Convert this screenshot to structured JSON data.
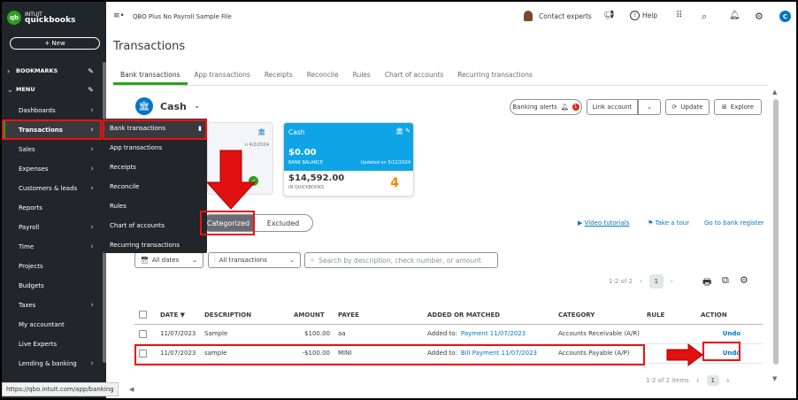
{
  "sidebar": {
    "logo_small": "INTUIT",
    "logo_brand": "quickbooks",
    "logo_mark": "qb",
    "new_label": "+ New",
    "sections": {
      "bookmarks": "BOOKMARKS",
      "menu": "MENU"
    },
    "items": [
      {
        "label": "Dashboards",
        "chev": true
      },
      {
        "label": "Transactions",
        "chev": true
      },
      {
        "label": "Sales",
        "chev": true
      },
      {
        "label": "Expenses",
        "chev": true
      },
      {
        "label": "Customers & leads",
        "chev": true
      },
      {
        "label": "Reports",
        "chev": false
      },
      {
        "label": "Payroll",
        "chev": true
      },
      {
        "label": "Time",
        "chev": true
      },
      {
        "label": "Projects",
        "chev": false
      },
      {
        "label": "Budgets",
        "chev": false
      },
      {
        "label": "Taxes",
        "chev": true
      },
      {
        "label": "My accountant",
        "chev": false
      },
      {
        "label": "Live Experts",
        "chev": false
      },
      {
        "label": "Lending & banking",
        "chev": true
      }
    ]
  },
  "flyout": [
    "Bank transactions",
    "App transactions",
    "Receipts",
    "Reconcile",
    "Rules",
    "Chart of accounts",
    "Recurring transactions"
  ],
  "status_url": "https://qbo.intuit.com/app/banking",
  "topbar": {
    "menu_icon": "≡•",
    "company": "QBO Plus No Payroll Sample File",
    "contact": "Contact experts",
    "help": "Help",
    "avatar": "C"
  },
  "page_title": "Transactions",
  "tabs": [
    "Bank transactions",
    "App transactions",
    "Receipts",
    "Reconcile",
    "Rules",
    "Chart of accounts",
    "Recurring transactions"
  ],
  "account": {
    "name": "Cash"
  },
  "actions": {
    "banking_alerts": "Banking alerts",
    "alerts_count": "1",
    "link_account": "Link account",
    "update": "Update",
    "explore": "Explore"
  },
  "card_gray": {
    "date": "n 4/2/2024"
  },
  "card_cash": {
    "title": "Cash",
    "bank_balance": "$0.00",
    "bank_label": "BANK BALANCE",
    "updated": "Updated on 5/12/2024",
    "qb_balance": "$14,592.00",
    "qb_label": "IN QUICKBOOKS",
    "count": "4"
  },
  "status_tabs": {
    "categorized": "Categorized",
    "excluded": "Excluded"
  },
  "help_links": {
    "video": "Video tutorials",
    "tour": "Take a tour",
    "register": "Go to bank register"
  },
  "filters": {
    "dates": "All dates",
    "transactions": "All transactions",
    "search_placeholder": "Search by description, check number, or amount"
  },
  "pagination": {
    "top": "1-2 of 2",
    "page": "1",
    "bottom": "1-2 of 2 items"
  },
  "table": {
    "headers": [
      "DATE ▼",
      "DESCRIPTION",
      "AMOUNT",
      "PAYEE",
      "ADDED OR MATCHED",
      "CATEGORY",
      "RULE",
      "ACTION"
    ],
    "rows": [
      {
        "date": "11/07/2023",
        "description": "Sample",
        "amount": "$100.00",
        "payee": "aa",
        "added_prefix": "Added to:",
        "added_link": "Payment 11/07/2023",
        "category": "Accounts Receivable (A/R)",
        "rule": "",
        "action": "Undo"
      },
      {
        "date": "11/07/2023",
        "description": "sample",
        "amount": "-$100.00",
        "payee": "MINI",
        "added_prefix": "Added to:",
        "added_link": "Bill Payment 11/07/2023",
        "category": "Accounts Payable (A/P)",
        "rule": "",
        "action": "Undo"
      }
    ]
  },
  "colors": {
    "brand_green": "#2ca01c",
    "sidebar_bg": "#21262a",
    "link_blue": "#0077c5",
    "card_blue": "#0fa4e6",
    "annotation_red": "#e11111"
  }
}
